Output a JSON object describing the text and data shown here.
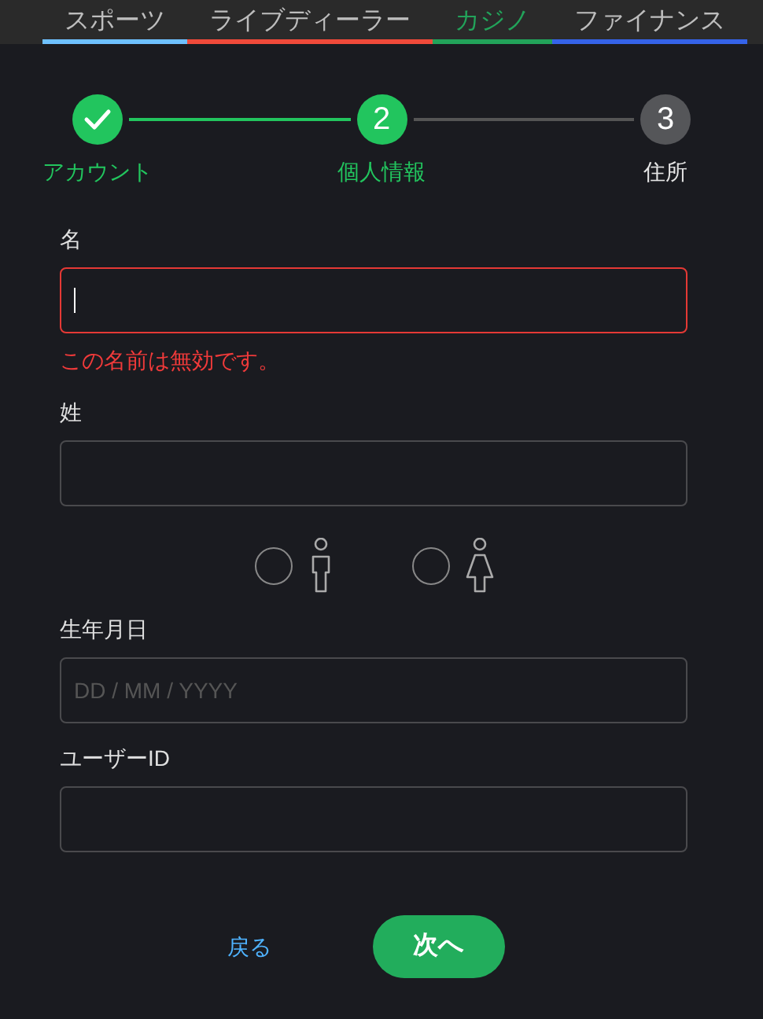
{
  "tabs": [
    {
      "label": "スポーツ",
      "selected": false,
      "color": "#6ec1ff"
    },
    {
      "label": "ライブディーラー",
      "selected": false,
      "color": "#f04a3a"
    },
    {
      "label": "カジノ",
      "selected": true,
      "color": "#22a35a"
    },
    {
      "label": "ファイナンス",
      "selected": false,
      "color": "#3563e9"
    }
  ],
  "steps": [
    {
      "kind": "done",
      "label": "アカウント"
    },
    {
      "kind": "current",
      "number": "2",
      "label": "個人情報"
    },
    {
      "kind": "upcoming",
      "number": "3",
      "label": "住所"
    }
  ],
  "form": {
    "fields": [
      {
        "kind": "text",
        "label": "名",
        "focused": true,
        "error": "この名前は無効です。"
      },
      {
        "kind": "text",
        "label": "姓",
        "focused": false
      },
      {
        "kind": "gender",
        "options": [
          {
            "kind": "male",
            "selected": false
          },
          {
            "kind": "female",
            "selected": false
          }
        ]
      },
      {
        "kind": "text",
        "label": "生年月日",
        "focused": false,
        "placeholder": "DD / MM / YYYY"
      },
      {
        "kind": "text",
        "label": "ユーザーID",
        "focused": false
      }
    ]
  },
  "actions": {
    "back": "戻る",
    "next": "次へ"
  }
}
